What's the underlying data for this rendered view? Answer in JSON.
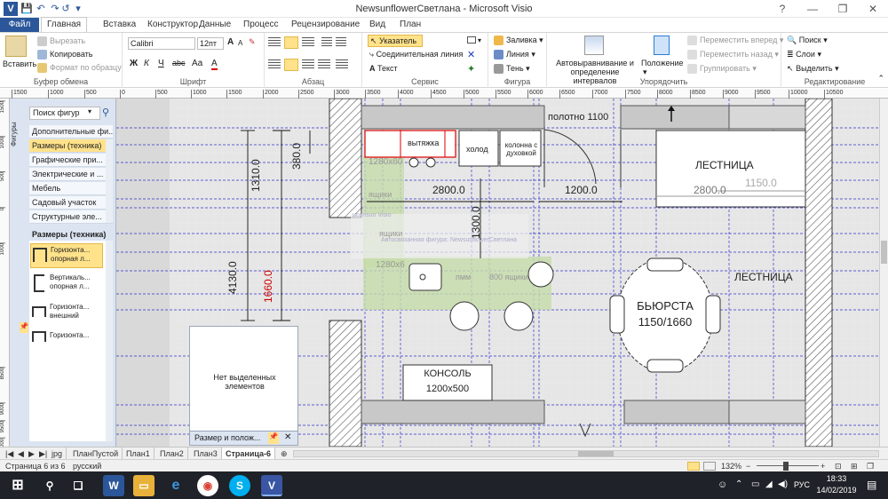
{
  "window": {
    "title": "NewsunflowerСветлана - Microsoft Visio",
    "controls": [
      "?",
      "—",
      "❐",
      "✕"
    ],
    "help_icon": "help-icon"
  },
  "quick_access": [
    "V",
    "💾",
    "↶",
    "↷",
    "↺",
    "▾"
  ],
  "tabs": [
    "Файл",
    "Главная",
    "Вставка",
    "Конструктор",
    "Данные",
    "Процесс",
    "Рецензирование",
    "Вид",
    "План"
  ],
  "ribbon": {
    "clipboard": {
      "label": "Буфер обмена",
      "paste": "Вставить",
      "cut": "Вырезать",
      "copy": "Копировать",
      "format": "Формат по образцу"
    },
    "font": {
      "label": "Шрифт",
      "font": "Calibri",
      "size": "12пт",
      "bold": "Ж",
      "italic": "К",
      "underline": "Ч",
      "strike": "abc",
      "case": "Aa",
      "color": "A",
      "grow": "A",
      "shrink": "A"
    },
    "paragraph": {
      "label": "Абзац"
    },
    "tools": {
      "label": "Сервис",
      "pointer": "Указатель",
      "connector": "Соединительная линия",
      "text": "Текст"
    },
    "shape": {
      "label": "Фигура",
      "fill": "Заливка",
      "line": "Линия",
      "shadow": "Тень"
    },
    "arrange": {
      "label": "Упорядочить",
      "auto": "Автовыравнивание и определение интервалов",
      "position": "Положение",
      "forward": "Переместить вперед",
      "backward": "Переместить назад",
      "group": "Группировать"
    },
    "editing": {
      "label": "Редактирование",
      "find": "Поиск",
      "layers": "Слои",
      "select": "Выделить"
    }
  },
  "ruler_top": [
    "1500",
    "1000",
    "500",
    "0",
    "500",
    "1000",
    "1500",
    "2000",
    "2500",
    "3000",
    "3500",
    "4000",
    "4500",
    "5000",
    "5500",
    "6000",
    "6500",
    "7000",
    "7500",
    "8000",
    "8500",
    "9000",
    "9500",
    "10000",
    "10500"
  ],
  "ruler_left": [
    "1500",
    "1000",
    "500",
    "0",
    "1000",
    "8500",
    "9000",
    "9500",
    "10000"
  ],
  "shapes_pane": {
    "vertical_label": "Фигуры",
    "search_value": "Поиск фигур",
    "categories": [
      "Дополнительные фи...",
      "Размеры (техника)",
      "Графические при...",
      "Электрические и ...",
      "Мебель",
      "Садовый участок",
      "Структурные эле..."
    ],
    "stencil_title": "Размеры (техника)",
    "stencil_items": [
      {
        "label": "Горизонта... опорная л..."
      },
      {
        "label": "Вертикаль... опорная л..."
      },
      {
        "label": "Горизонта... внешний"
      },
      {
        "label": "Горизонта..."
      }
    ]
  },
  "size_panel": {
    "text": "Нет выделенных элементов",
    "title": "Размер и полож..."
  },
  "plan": {
    "dims_vertical": [
      "1310.0",
      "380.0",
      "4130.0",
      "1660.0",
      "1300.0"
    ],
    "dims_horizontal": [
      "2800.0",
      "1200.0",
      "2800.0",
      "1150.0"
    ],
    "labels": {
      "door": "полотно 1100",
      "hood": "вытяжка",
      "fridge": "холод",
      "oven": "колонна с духовкой",
      "cab1": "1280x60",
      "drawers1": "ящики",
      "drawers2": "ящики",
      "cab2": "1280x6",
      "dishwasher": "пмм",
      "drawers800": "800 ящики",
      "stairs1": "ЛЕСТНИЦА",
      "stairs2": "ЛЕСТНИЦА",
      "bar": "БЬЮРСТА",
      "bar_size": "1150/1660",
      "console": "КОНСОЛЬ",
      "console_size": "1200x500",
      "ghost1": "Автосвязанная фигура: NewsunflowerСветлана",
      "ghost2": "ucensun Visio"
    }
  },
  "page_tabs": [
    "jpg",
    "ПланПустой",
    "План1",
    "План2",
    "План3",
    "Страница-6"
  ],
  "status": {
    "page": "Страница 6 из 6",
    "lang": "русский",
    "zoom": "132%"
  },
  "taskbar": {
    "time": "18:33",
    "date": "14/02/2019",
    "lang": "РУС"
  },
  "colors": {
    "accent": "#2b579a",
    "selected": "#ffe28a",
    "wall_hatch": "#555555",
    "gray_wall": "#c8c8c8",
    "dim_red": "#cc0000",
    "green_counter": "#c6dcaa",
    "grid_blue": "#2222cc"
  }
}
